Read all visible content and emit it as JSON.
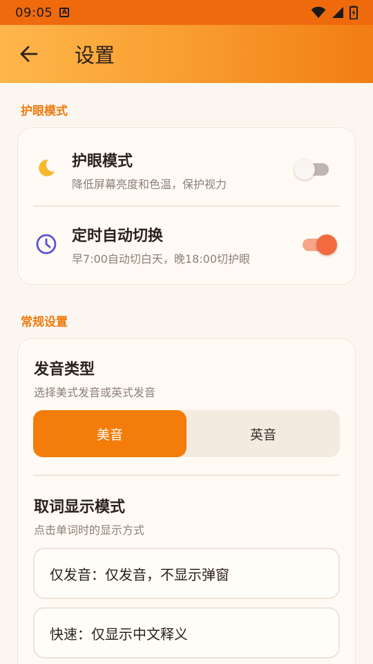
{
  "status_bar": {
    "time": "09:05",
    "notification_icon": "text-a-icon",
    "icons": [
      "wifi-icon",
      "signal-icon",
      "battery-charging-icon"
    ]
  },
  "app_bar": {
    "back_icon": "arrow-left-icon",
    "title": "设置"
  },
  "eye_section": {
    "label": "护眼模式",
    "items": [
      {
        "icon": "moon-icon",
        "icon_color": "#F5B82E",
        "title": "护眼模式",
        "subtitle": "降低屏幕亮度和色温，保护视力",
        "enabled": false
      },
      {
        "icon": "clock-icon",
        "icon_color": "#5B4FD6",
        "title": "定时自动切换",
        "subtitle": "早7:00自动切白天，晚18:00切护眼",
        "enabled": true
      }
    ]
  },
  "general_section": {
    "label": "常规设置",
    "pronunciation": {
      "title": "发音类型",
      "subtitle": "选择美式发音或英式发音",
      "options": [
        "美音",
        "英音"
      ],
      "selected": "美音"
    },
    "display_mode": {
      "title": "取词显示模式",
      "subtitle": "点击单词时的显示方式",
      "options": [
        "仅发音：仅发音，不显示弹窗",
        "快速：仅显示中文释义"
      ]
    }
  },
  "colors": {
    "accent": "#F47C0A",
    "status_bar": "#EE6A0D",
    "switch_on": "#F26A3D",
    "background": "#FBF7F0"
  }
}
